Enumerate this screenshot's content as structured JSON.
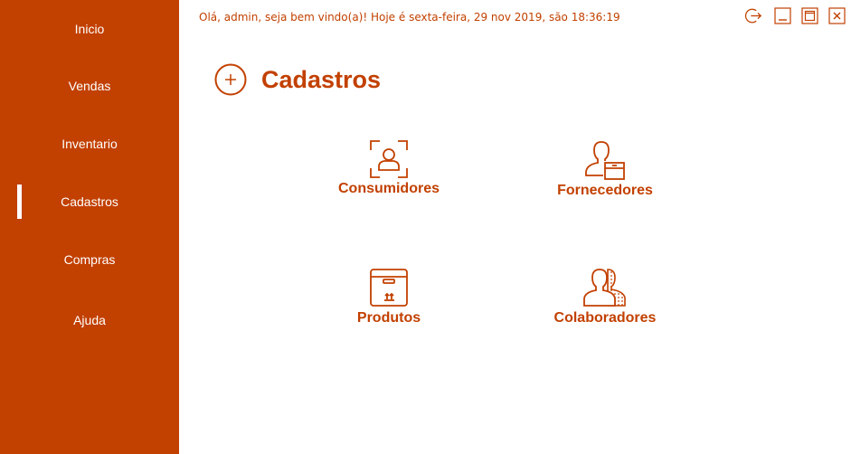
{
  "sidebar": {
    "items": [
      {
        "label": "Inicio"
      },
      {
        "label": "Vendas"
      },
      {
        "label": "Inventario"
      },
      {
        "label": "Cadastros",
        "active": true
      },
      {
        "label": "Compras"
      },
      {
        "label": "Ajuda"
      }
    ]
  },
  "header": {
    "greeting": "Olá, admin, seja bem vindo(a)! Hoje é sexta-feira, 29 nov 2019, são 18:36:19",
    "window_controls": [
      "logout-icon",
      "minimize-icon",
      "maximize-icon",
      "close-icon"
    ]
  },
  "page": {
    "title": "Cadastros",
    "title_icon": "plus-circle-icon"
  },
  "cards": [
    {
      "label": "Consumidores",
      "icon": "user-scan-icon"
    },
    {
      "label": "Fornecedores",
      "icon": "supplier-icon"
    },
    {
      "label": "Produtos",
      "icon": "package-icon"
    },
    {
      "label": "Colaboradores",
      "icon": "team-icon"
    }
  ],
  "colors": {
    "accent": "#c24000",
    "sidebar_text": "#ffffff",
    "background": "#ffffff"
  }
}
